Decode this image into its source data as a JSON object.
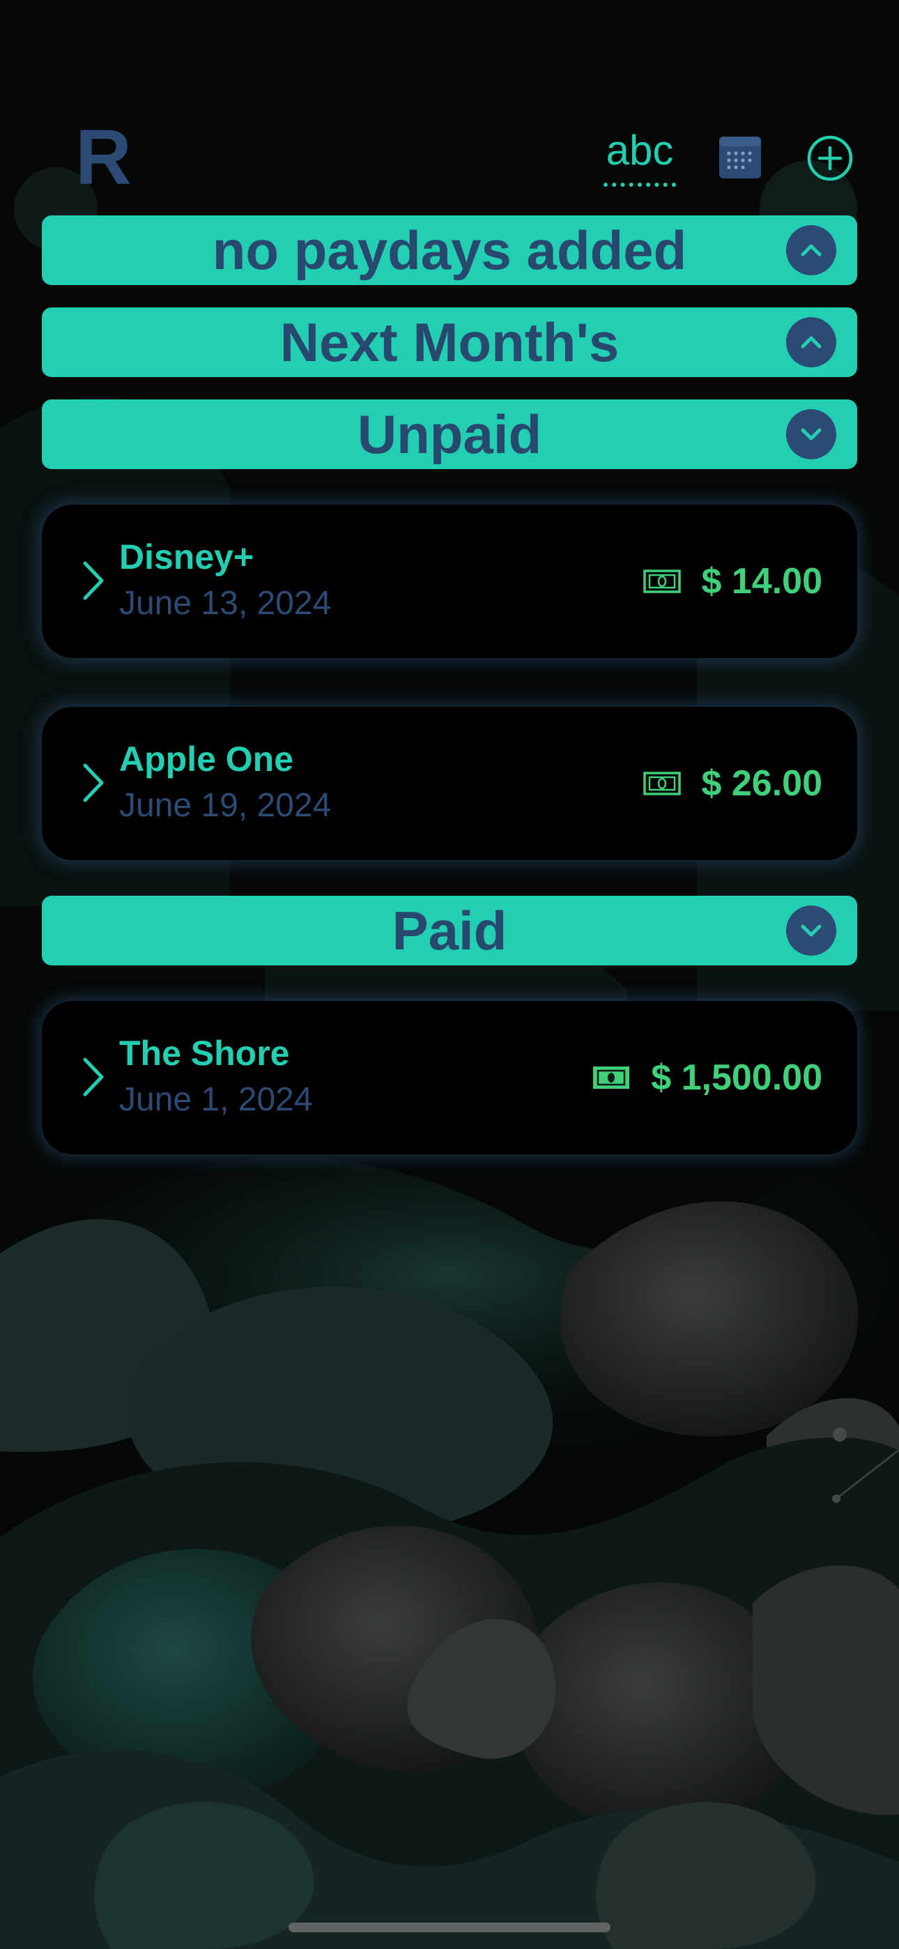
{
  "header": {
    "app_letter": "R",
    "sort_label": "abc",
    "calendar_icon": "calendar-icon",
    "add_icon": "plus-circle-icon"
  },
  "sections": {
    "paydays": {
      "label": "no paydays added",
      "state": "collapsed"
    },
    "next_month": {
      "label": "Next Month's",
      "state": "collapsed"
    },
    "unpaid": {
      "label": "Unpaid",
      "state": "expanded"
    },
    "paid": {
      "label": "Paid",
      "state": "expanded"
    }
  },
  "unpaid_bills": [
    {
      "name": "Disney+",
      "date": "June 13, 2024",
      "amount": "$ 14.00",
      "icon": "banknote-outline-icon"
    },
    {
      "name": "Apple One",
      "date": "June 19, 2024",
      "amount": "$ 26.00",
      "icon": "banknote-outline-icon"
    }
  ],
  "paid_bills": [
    {
      "name": "The Shore",
      "date": "June 1, 2024",
      "amount": "$ 1,500.00",
      "icon": "banknote-filled-icon"
    }
  ],
  "colors": {
    "accent": "#23cfb3",
    "navy": "#2c4a73",
    "money_green": "#3fd07c",
    "background": "#040706"
  }
}
